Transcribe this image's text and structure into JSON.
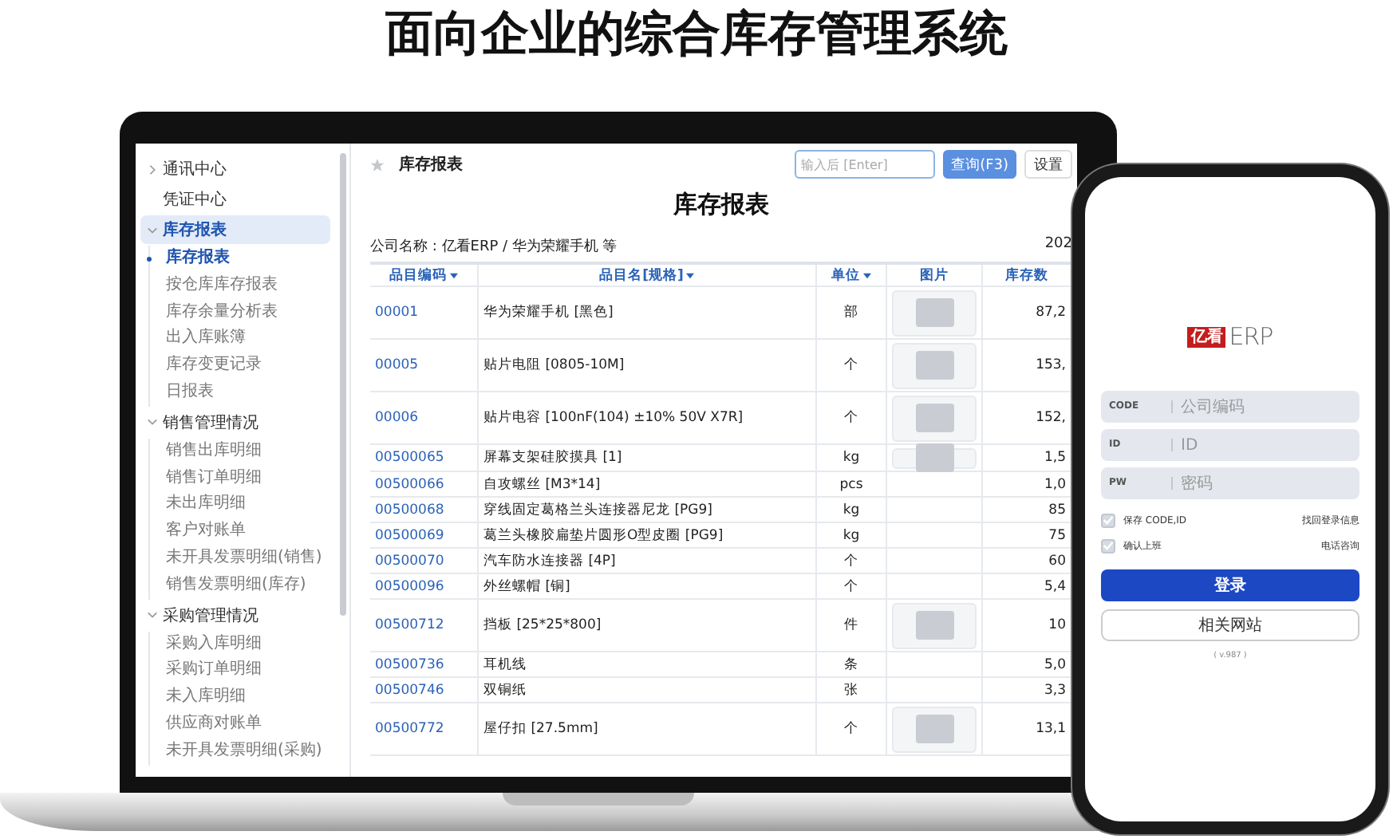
{
  "headline": "面向企业的综合库存管理系统",
  "sidebar": {
    "items": [
      {
        "label": "通讯中心",
        "expandable": true,
        "expanded": false,
        "selected": false
      },
      {
        "label": "凭证中心",
        "expandable": false,
        "selected": false
      },
      {
        "label": "库存报表",
        "expandable": true,
        "expanded": true,
        "selected": true,
        "children": [
          {
            "label": "库存报表",
            "selected": true
          },
          {
            "label": "按仓库库存报表",
            "selected": false
          },
          {
            "label": "库存余量分析表",
            "selected": false
          },
          {
            "label": "出入库账簿",
            "selected": false
          },
          {
            "label": "库存变更记录",
            "selected": false
          },
          {
            "label": "日报表",
            "selected": false
          }
        ]
      },
      {
        "label": "销售管理情况",
        "expandable": true,
        "expanded": true,
        "selected": false,
        "children": [
          {
            "label": "销售出库明细",
            "selected": false
          },
          {
            "label": "销售订单明细",
            "selected": false
          },
          {
            "label": "未出库明细",
            "selected": false
          },
          {
            "label": "客户对账单",
            "selected": false
          },
          {
            "label": "未开具发票明细(销售)",
            "selected": false
          },
          {
            "label": "销售发票明细(库存)",
            "selected": false
          }
        ]
      },
      {
        "label": "采购管理情况",
        "expandable": true,
        "expanded": true,
        "selected": false,
        "children": [
          {
            "label": "采购入库明细",
            "selected": false
          },
          {
            "label": "采购订单明细",
            "selected": false
          },
          {
            "label": "未入库明细",
            "selected": false
          },
          {
            "label": "供应商对账单",
            "selected": false
          },
          {
            "label": "未开具发票明细(采购)",
            "selected": false
          }
        ]
      }
    ]
  },
  "toolbar": {
    "page_title": "库存报表",
    "search": {
      "placeholder": "输入后 [Enter]"
    },
    "query_button": "查询(F3)",
    "settings_button": "设置"
  },
  "report": {
    "title": "库存报表",
    "company": "公司名称 : 亿看ERP / 华为荣耀手机 等",
    "date": "202"
  },
  "table": {
    "columns": [
      {
        "label": "品目编码",
        "sortable": true
      },
      {
        "label": "品目名[规格]",
        "sortable": true
      },
      {
        "label": "单位",
        "sortable": true
      },
      {
        "label": "图片",
        "sortable": false
      },
      {
        "label": "库存数",
        "sortable": false
      }
    ],
    "rows": [
      {
        "code": "00001",
        "name": "华为荣耀手机 [黑色]",
        "unit": "部",
        "photo": true,
        "stock": "87,2"
      },
      {
        "code": "00005",
        "name": "贴片电阻 [0805-10M]",
        "unit": "个",
        "photo": true,
        "stock": "153,"
      },
      {
        "code": "00006",
        "name": "贴片电容 [100nF(104) ±10% 50V X7R]",
        "unit": "个",
        "photo": true,
        "stock": "152,"
      },
      {
        "code": "00500065",
        "name": "屏幕支架硅胶摸具 [1]",
        "unit": "kg",
        "photo": true,
        "stock": "1,5"
      },
      {
        "code": "00500066",
        "name": "自攻螺丝 [M3*14]",
        "unit": "pcs",
        "photo": false,
        "stock": "1,0"
      },
      {
        "code": "00500068",
        "name": "穿线固定葛格兰头连接器尼龙 [PG9]",
        "unit": "kg",
        "photo": false,
        "stock": "85"
      },
      {
        "code": "00500069",
        "name": "葛兰头橡胶扁垫片圆形O型皮圈 [PG9]",
        "unit": "kg",
        "photo": false,
        "stock": "75"
      },
      {
        "code": "00500070",
        "name": "汽车防水连接器 [4P]",
        "unit": "个",
        "photo": false,
        "stock": "60"
      },
      {
        "code": "00500096",
        "name": "外丝螺帽 [铜]",
        "unit": "个",
        "photo": false,
        "stock": "5,4"
      },
      {
        "code": "00500712",
        "name": "挡板 [25*25*800]",
        "unit": "件",
        "photo": true,
        "stock": "10"
      },
      {
        "code": "00500736",
        "name": "耳机线",
        "unit": "条",
        "photo": false,
        "stock": "5,0"
      },
      {
        "code": "00500746",
        "name": "双铜纸",
        "unit": "张",
        "photo": false,
        "stock": "3,3"
      },
      {
        "code": "00500772",
        "name": "屋仔扣 [27.5mm]",
        "unit": "个",
        "photo": true,
        "stock": "13,1"
      }
    ]
  },
  "phone": {
    "logo": {
      "mark": "亿看",
      "text": "ERP"
    },
    "fields": [
      {
        "label": "CODE",
        "placeholder": "公司编码"
      },
      {
        "label": "ID",
        "placeholder": "ID"
      },
      {
        "label": "PW",
        "placeholder": "密码"
      }
    ],
    "options": [
      {
        "label": "保存 CODE,ID",
        "checked": true,
        "link": "找回登录信息"
      },
      {
        "label": "确认上班",
        "checked": true,
        "link": "电话咨询"
      }
    ],
    "login_button": "登录",
    "sites_button": "相关网站",
    "version": "( v.987 )"
  }
}
